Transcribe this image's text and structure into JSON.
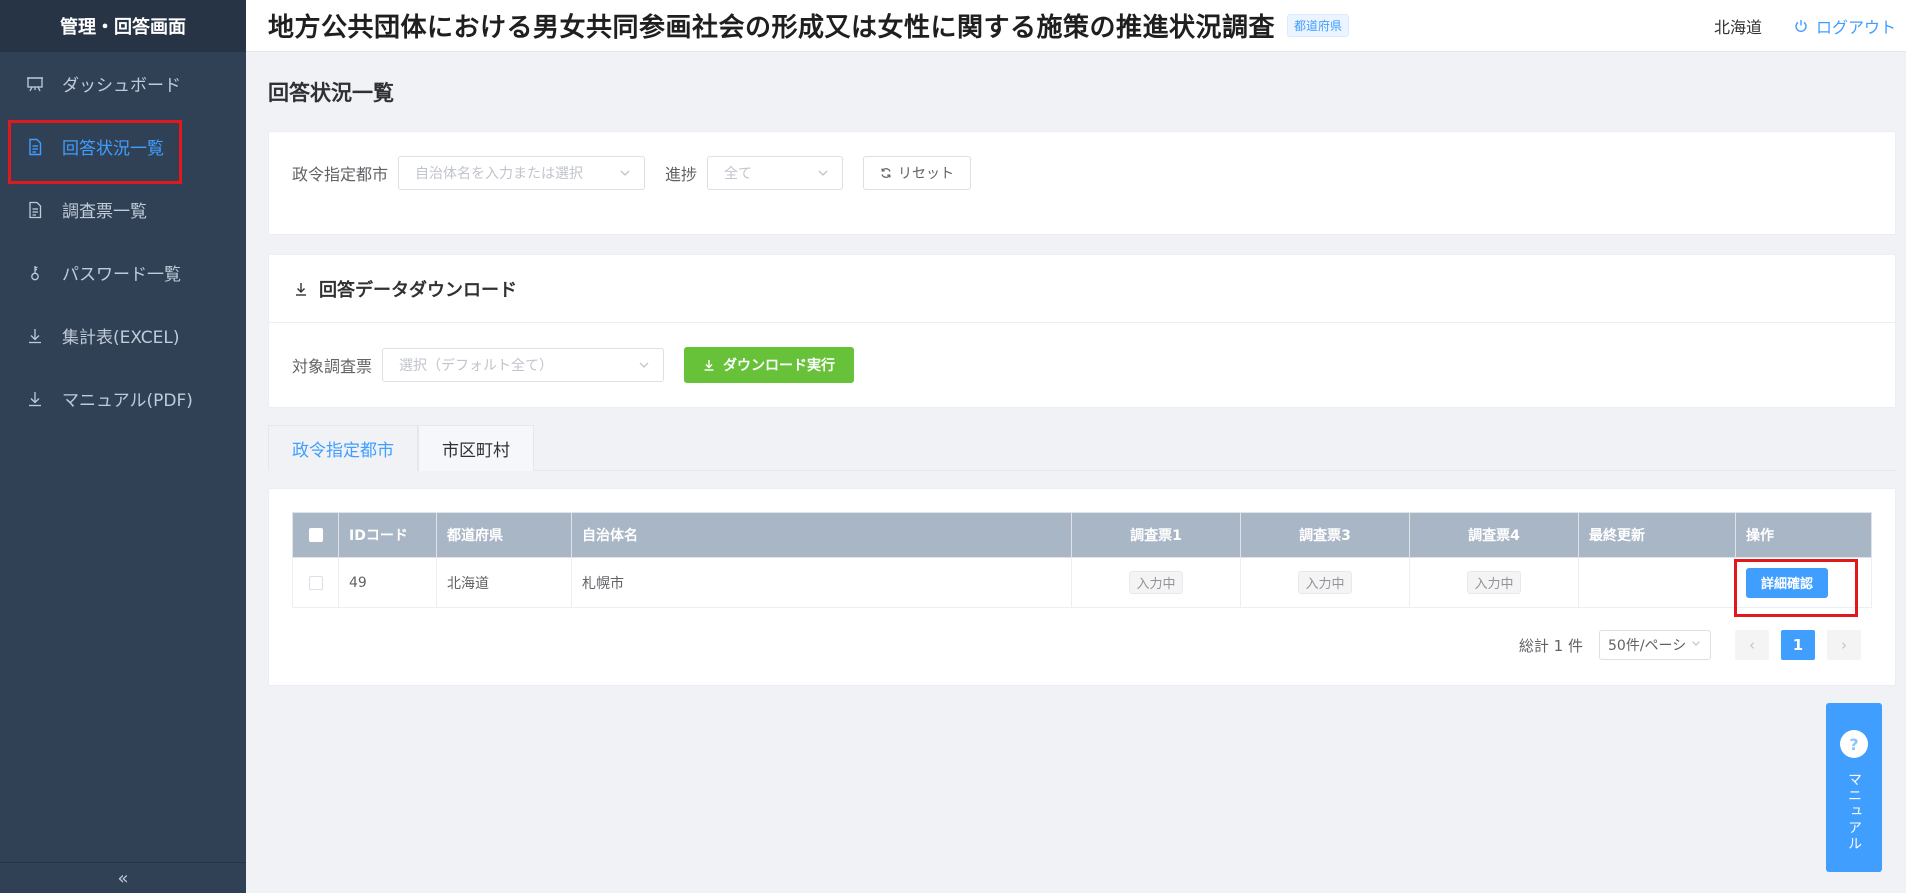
{
  "sidebar": {
    "title": "管理・回答画面",
    "items": [
      {
        "label": "ダッシュボード",
        "icon": "presentation-board-icon"
      },
      {
        "label": "回答状況一覧",
        "icon": "document-icon"
      },
      {
        "label": "調査票一覧",
        "icon": "document-icon"
      },
      {
        "label": "パスワード一覧",
        "icon": "key-icon"
      },
      {
        "label": "集計表(EXCEL)",
        "icon": "download-icon"
      },
      {
        "label": "マニュアル(PDF)",
        "icon": "download-icon"
      }
    ],
    "collapse_label": "«"
  },
  "header": {
    "title": "地方公共団体における男女共同参画社会の形成又は女性に関する施策の推進状況調査",
    "badge": "都道府県",
    "prefecture": "北海道",
    "logout_label": "ログアウト"
  },
  "page": {
    "title": "回答状況一覧"
  },
  "filter": {
    "city_label": "政令指定都市",
    "city_placeholder": "自治体名を入力または選択",
    "progress_label": "進捗",
    "progress_value": "全て",
    "reset_label": "リセット"
  },
  "download": {
    "title": "回答データダウンロード",
    "target_label": "対象調査票",
    "target_placeholder": "選択（デフォルト全て）",
    "execute_label": "ダウンロード実行"
  },
  "tabs": [
    "政令指定都市",
    "市区町村"
  ],
  "table": {
    "columns": [
      "IDコード",
      "都道府県",
      "自治体名",
      "調査票1",
      "調査票3",
      "調査票4",
      "最終更新",
      "操作"
    ],
    "rows": [
      {
        "id": "49",
        "prefecture": "北海道",
        "name": "札幌市",
        "s1": "入力中",
        "s3": "入力中",
        "s4": "入力中",
        "updated": "",
        "action": "詳細確認"
      }
    ]
  },
  "pagination": {
    "total": "総計 1 件",
    "page_size": "50件/ペーシ",
    "current": "1",
    "prev": "‹",
    "next": "›"
  },
  "manual_float": {
    "icon_glyph": "?",
    "label": "マニュアル"
  },
  "colors": {
    "sidebar_bg": "#304156",
    "accent": "#409eff",
    "success": "#67c23a",
    "highlight_box": "#e0191d"
  }
}
